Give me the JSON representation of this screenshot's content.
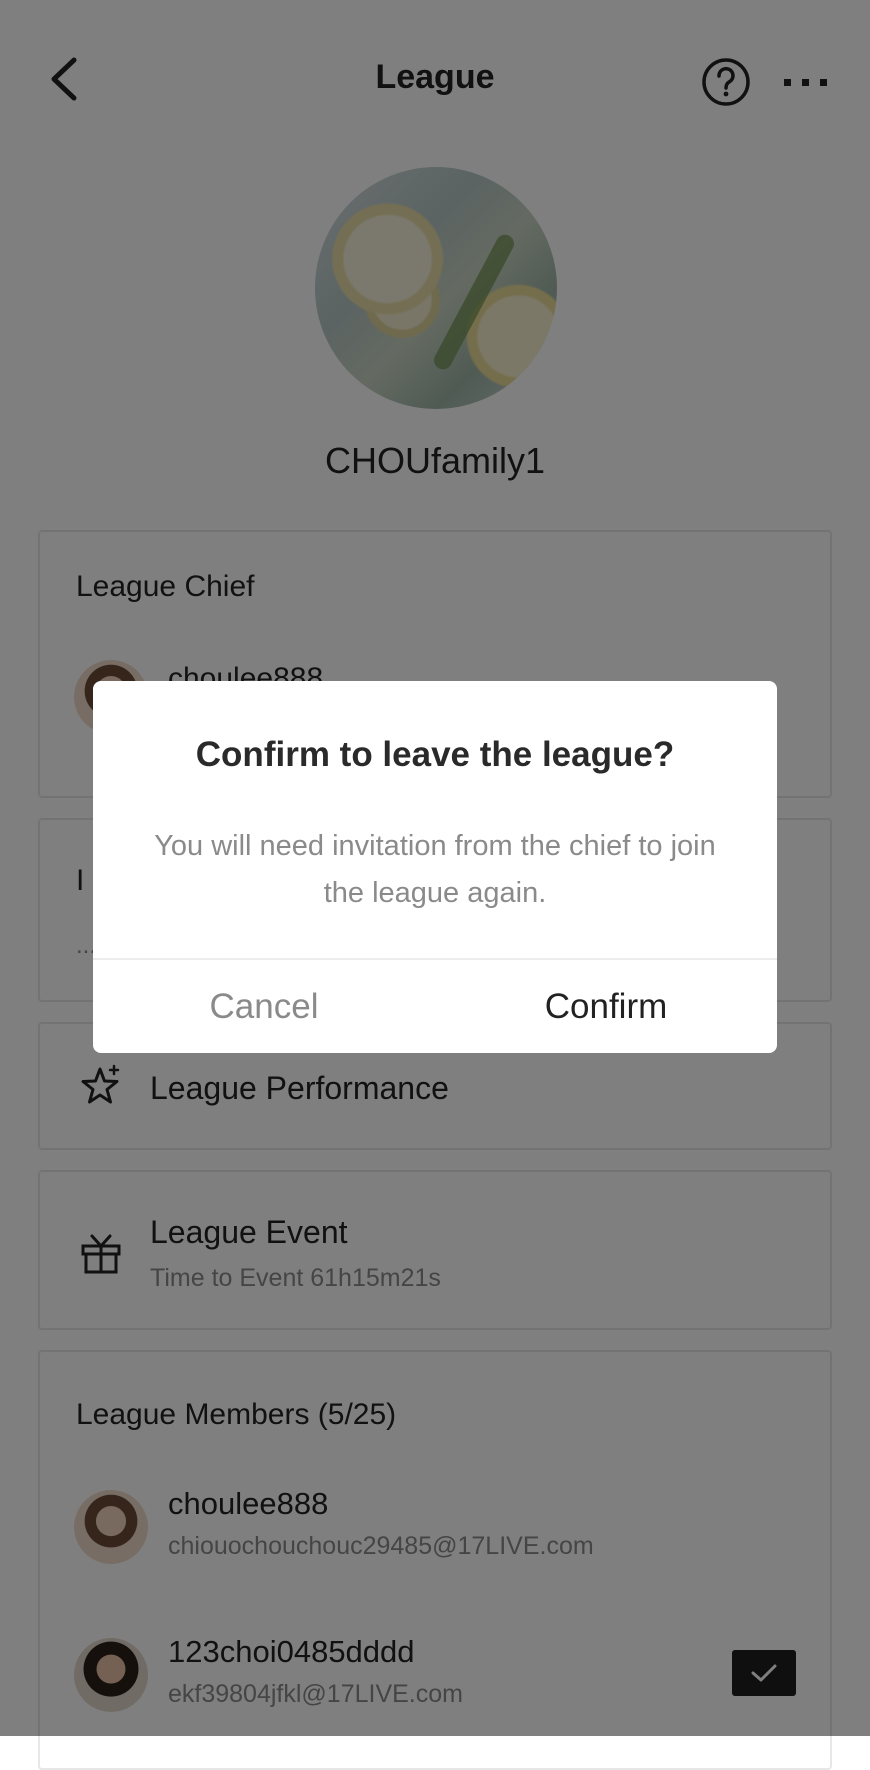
{
  "header": {
    "title": "League",
    "back_icon": "chevron-left-icon",
    "help_icon": "question-circle-icon",
    "more_icon": "more-dots-icon"
  },
  "league": {
    "name": "CHOUfamily1"
  },
  "chief_section": {
    "heading": "League Chief",
    "chief_name": "choulee888"
  },
  "intro_section": {
    "heading_visible": "I",
    "text_visible": "..."
  },
  "performance": {
    "label": "League Performance",
    "icon": "star-sparkle-icon"
  },
  "event": {
    "label": "League Event",
    "countdown": "Time to Event 61h15m21s",
    "icon": "gift-icon"
  },
  "members": {
    "heading": "League Members (5/25)",
    "items": [
      {
        "name": "choulee888",
        "email": "chiouochouchouc29485@17LIVE.com",
        "checked": false
      },
      {
        "name": "123choi0485dddd",
        "email": "ekf39804jfkl@17LIVE.com",
        "checked": true
      }
    ]
  },
  "dialog": {
    "title": "Confirm to leave the league?",
    "message": "You will need invitation from the chief to join the league again.",
    "cancel_label": "Cancel",
    "confirm_label": "Confirm"
  },
  "colors": {
    "overlay": "#000000",
    "dialog_background": "#ffffff",
    "muted_text": "#8a8a8a"
  }
}
